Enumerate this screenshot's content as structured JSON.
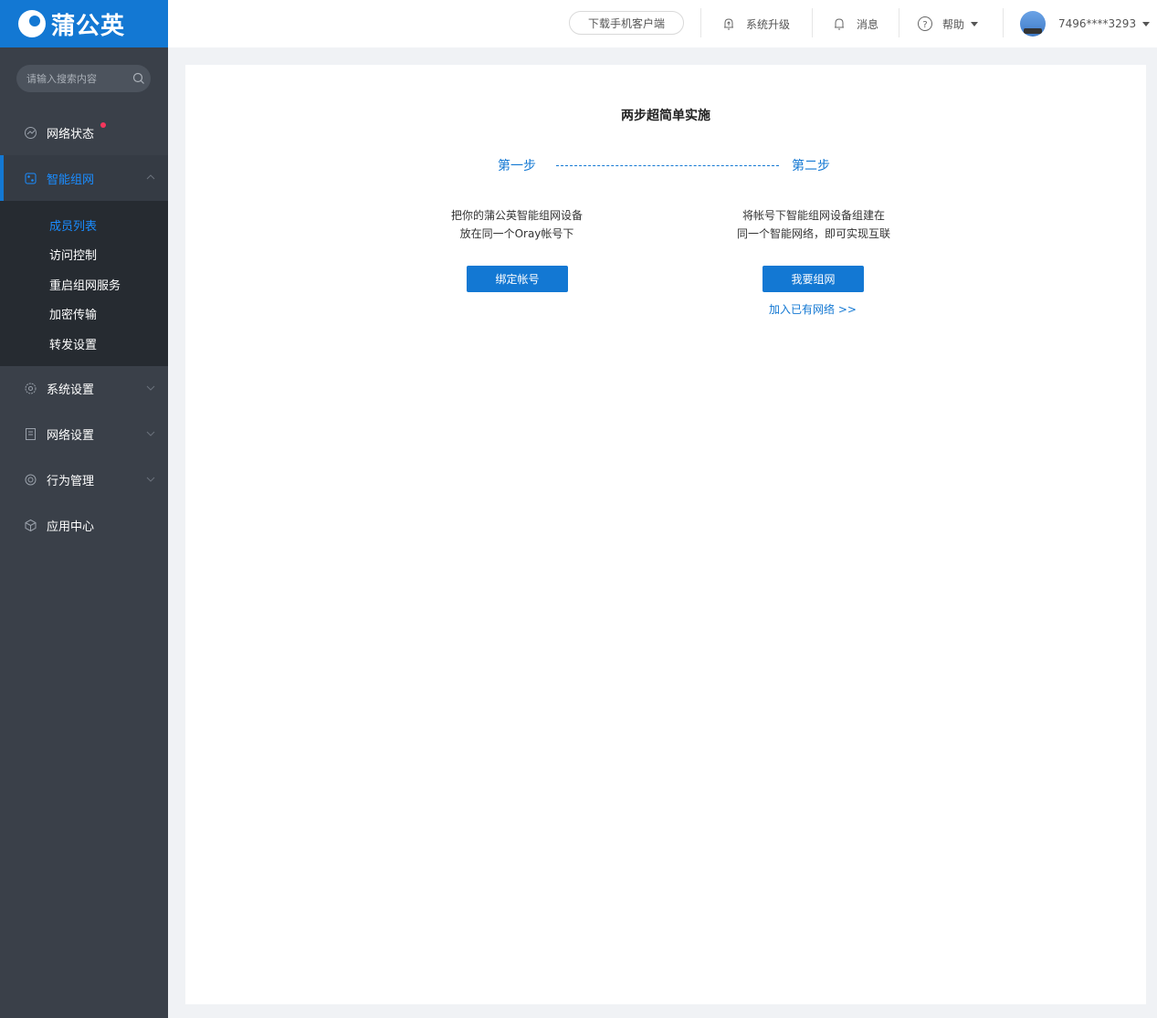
{
  "brand": {
    "name": "蒲公英"
  },
  "search": {
    "placeholder": "请输入搜索内容"
  },
  "sidebar": {
    "items": [
      {
        "label": "网络状态"
      },
      {
        "label": "智能组网"
      },
      {
        "label": "系统设置"
      },
      {
        "label": "网络设置"
      },
      {
        "label": "行为管理"
      },
      {
        "label": "应用中心"
      }
    ],
    "subitems": [
      {
        "label": "成员列表"
      },
      {
        "label": "访问控制"
      },
      {
        "label": "重启组网服务"
      },
      {
        "label": "加密传输"
      },
      {
        "label": "转发设置"
      }
    ]
  },
  "header": {
    "download": "下载手机客户端",
    "upgrade": "系统升级",
    "messages": "消息",
    "help": "帮助",
    "user": "7496****3293"
  },
  "main": {
    "title": "两步超简单实施",
    "step1": {
      "label": "第一步",
      "line1": "把你的蒲公英智能组网设备",
      "line2": "放在同一个Oray帐号下",
      "button": "绑定帐号"
    },
    "step2": {
      "label": "第二步",
      "line1": "将帐号下智能组网设备组建在",
      "line2": "同一个智能网络，即可实现互联",
      "button": "我要组网",
      "link": "加入已有网络 >>"
    }
  },
  "colors": {
    "brand": "#1378d3",
    "sidebar": "#3a4049",
    "submenu": "#262b31",
    "badge": "#f5365c"
  }
}
